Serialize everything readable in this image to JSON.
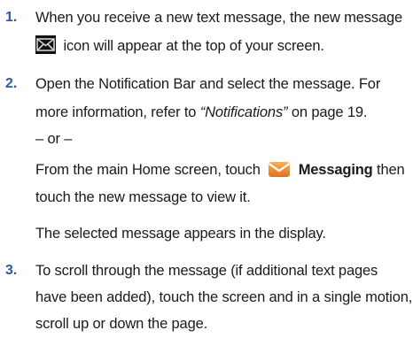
{
  "steps": [
    {
      "number": "1.",
      "lines": [
        "When you receive a new text message, the new message",
        "icon will appear at the top of your screen."
      ]
    },
    {
      "number": "2.",
      "line1": "Open the Notification Bar and select the message. For",
      "line2_prefix": "more information, refer to",
      "line2_ref": "“Notifications”",
      "line2_suffix": "on page 19.",
      "or_text": "– or –",
      "home_prefix": "From the main Home screen, touch",
      "messaging_label": "Messaging",
      "home_suffix": "then",
      "home_line2": "touch the new message to view it.",
      "result": "The selected message appears in the display."
    },
    {
      "number": "3.",
      "lines": [
        "To scroll through the message (if additional text pages",
        "have been added), touch the screen and in a single motion,",
        "scroll up or down the page."
      ]
    }
  ],
  "icons": {
    "new_message": "new-message-envelope-icon",
    "messaging": "messaging-app-icon"
  },
  "colors": {
    "step_number": "#2a5aa8",
    "messaging_icon": "#e8892a"
  }
}
